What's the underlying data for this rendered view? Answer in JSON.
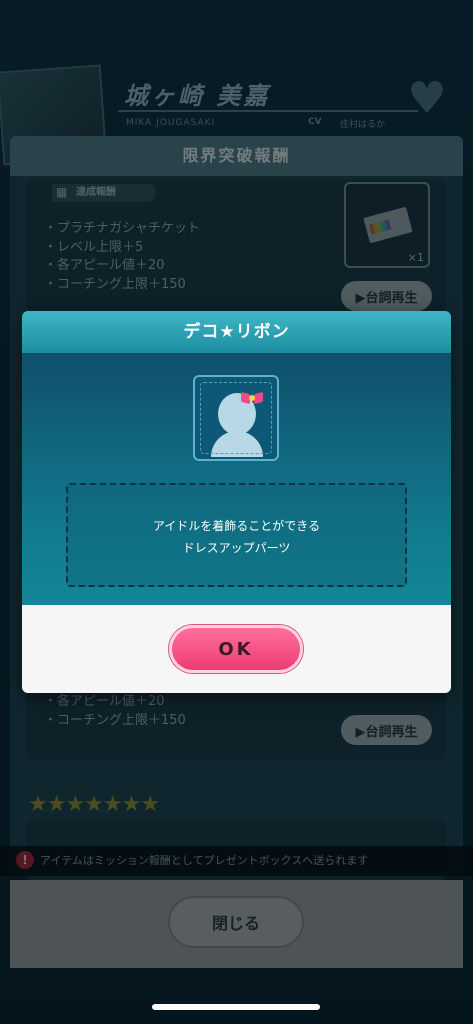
{
  "header": {
    "character_name": "城ヶ崎 美嘉",
    "character_romaji": "MIKA JOUGASAKI",
    "cv_label": "CV",
    "cv_name": "佳村はるか",
    "logo_icon": "heart-icon"
  },
  "panel": {
    "title": "限界突破報酬",
    "reward_tag": "達成報酬",
    "rewards_top": [
      "プラチナガシャチケット",
      "レベル上限＋5",
      "各アピール値＋20",
      "コーチング上限＋150"
    ],
    "ticket_count": "×1",
    "voice_button": "▶台詞再生",
    "rewards_bottom": [
      "各アピール値＋20",
      "コーチング上限＋150"
    ],
    "voice_button_2": "▶台詞再生",
    "stars": "★★★★★★★",
    "star_count": 7
  },
  "notice": {
    "icon": "!",
    "text": "アイテムはミッション報酬としてプレゼントボックスへ送られます"
  },
  "footer": {
    "close_label": "閉じる"
  },
  "modal": {
    "title": "デコ★リボン",
    "description_line1": "アイドルを着飾ることができる",
    "description_line2": "ドレスアップパーツ",
    "ok_label": "OK"
  },
  "colors": {
    "modal_header": "#2aa3b5",
    "ok_button": "#f04e80",
    "panel_bg": "#1e4655"
  }
}
